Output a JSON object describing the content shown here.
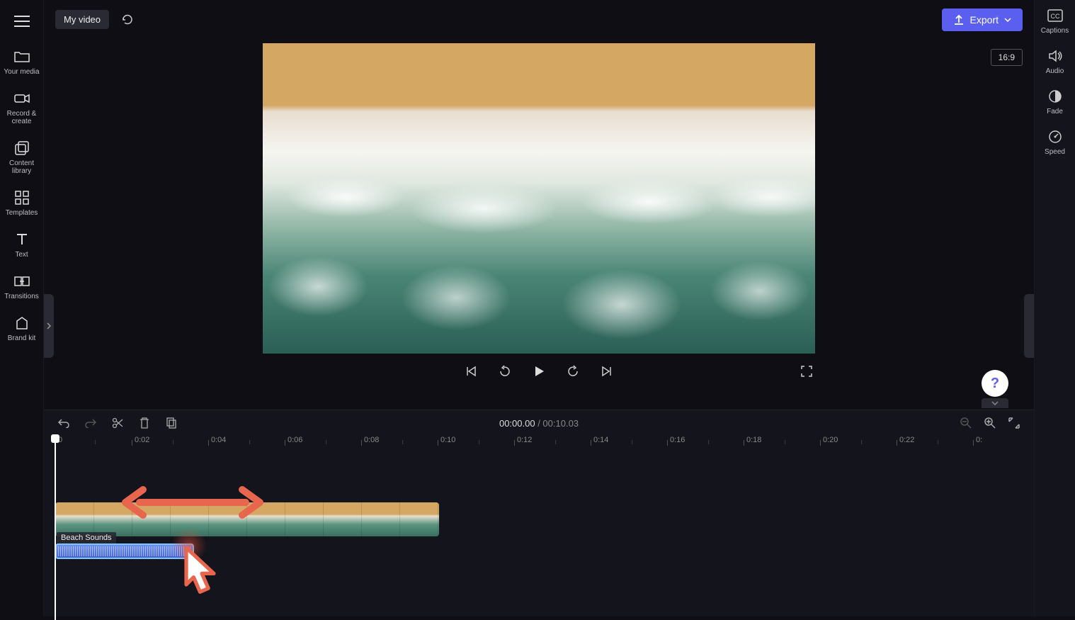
{
  "header": {
    "project_title": "My video",
    "export_label": "Export",
    "aspect_ratio": "16:9"
  },
  "left_sidebar": {
    "items": [
      {
        "label": "Your media"
      },
      {
        "label": "Record & create"
      },
      {
        "label": "Content library"
      },
      {
        "label": "Templates"
      },
      {
        "label": "Text"
      },
      {
        "label": "Transitions"
      },
      {
        "label": "Brand kit"
      }
    ]
  },
  "right_sidebar": {
    "items": [
      {
        "label": "Captions"
      },
      {
        "label": "Audio"
      },
      {
        "label": "Fade"
      },
      {
        "label": "Speed"
      }
    ]
  },
  "timeline": {
    "current_time": "00:00.00",
    "total_duration": "00:10.03",
    "ruler": [
      "0",
      "0:02",
      "0:04",
      "0:06",
      "0:08",
      "0:10",
      "0:12",
      "0:14",
      "0:16",
      "0:18",
      "0:20",
      "0:22",
      "0:"
    ],
    "audio_clip_label": "Beach Sounds"
  }
}
